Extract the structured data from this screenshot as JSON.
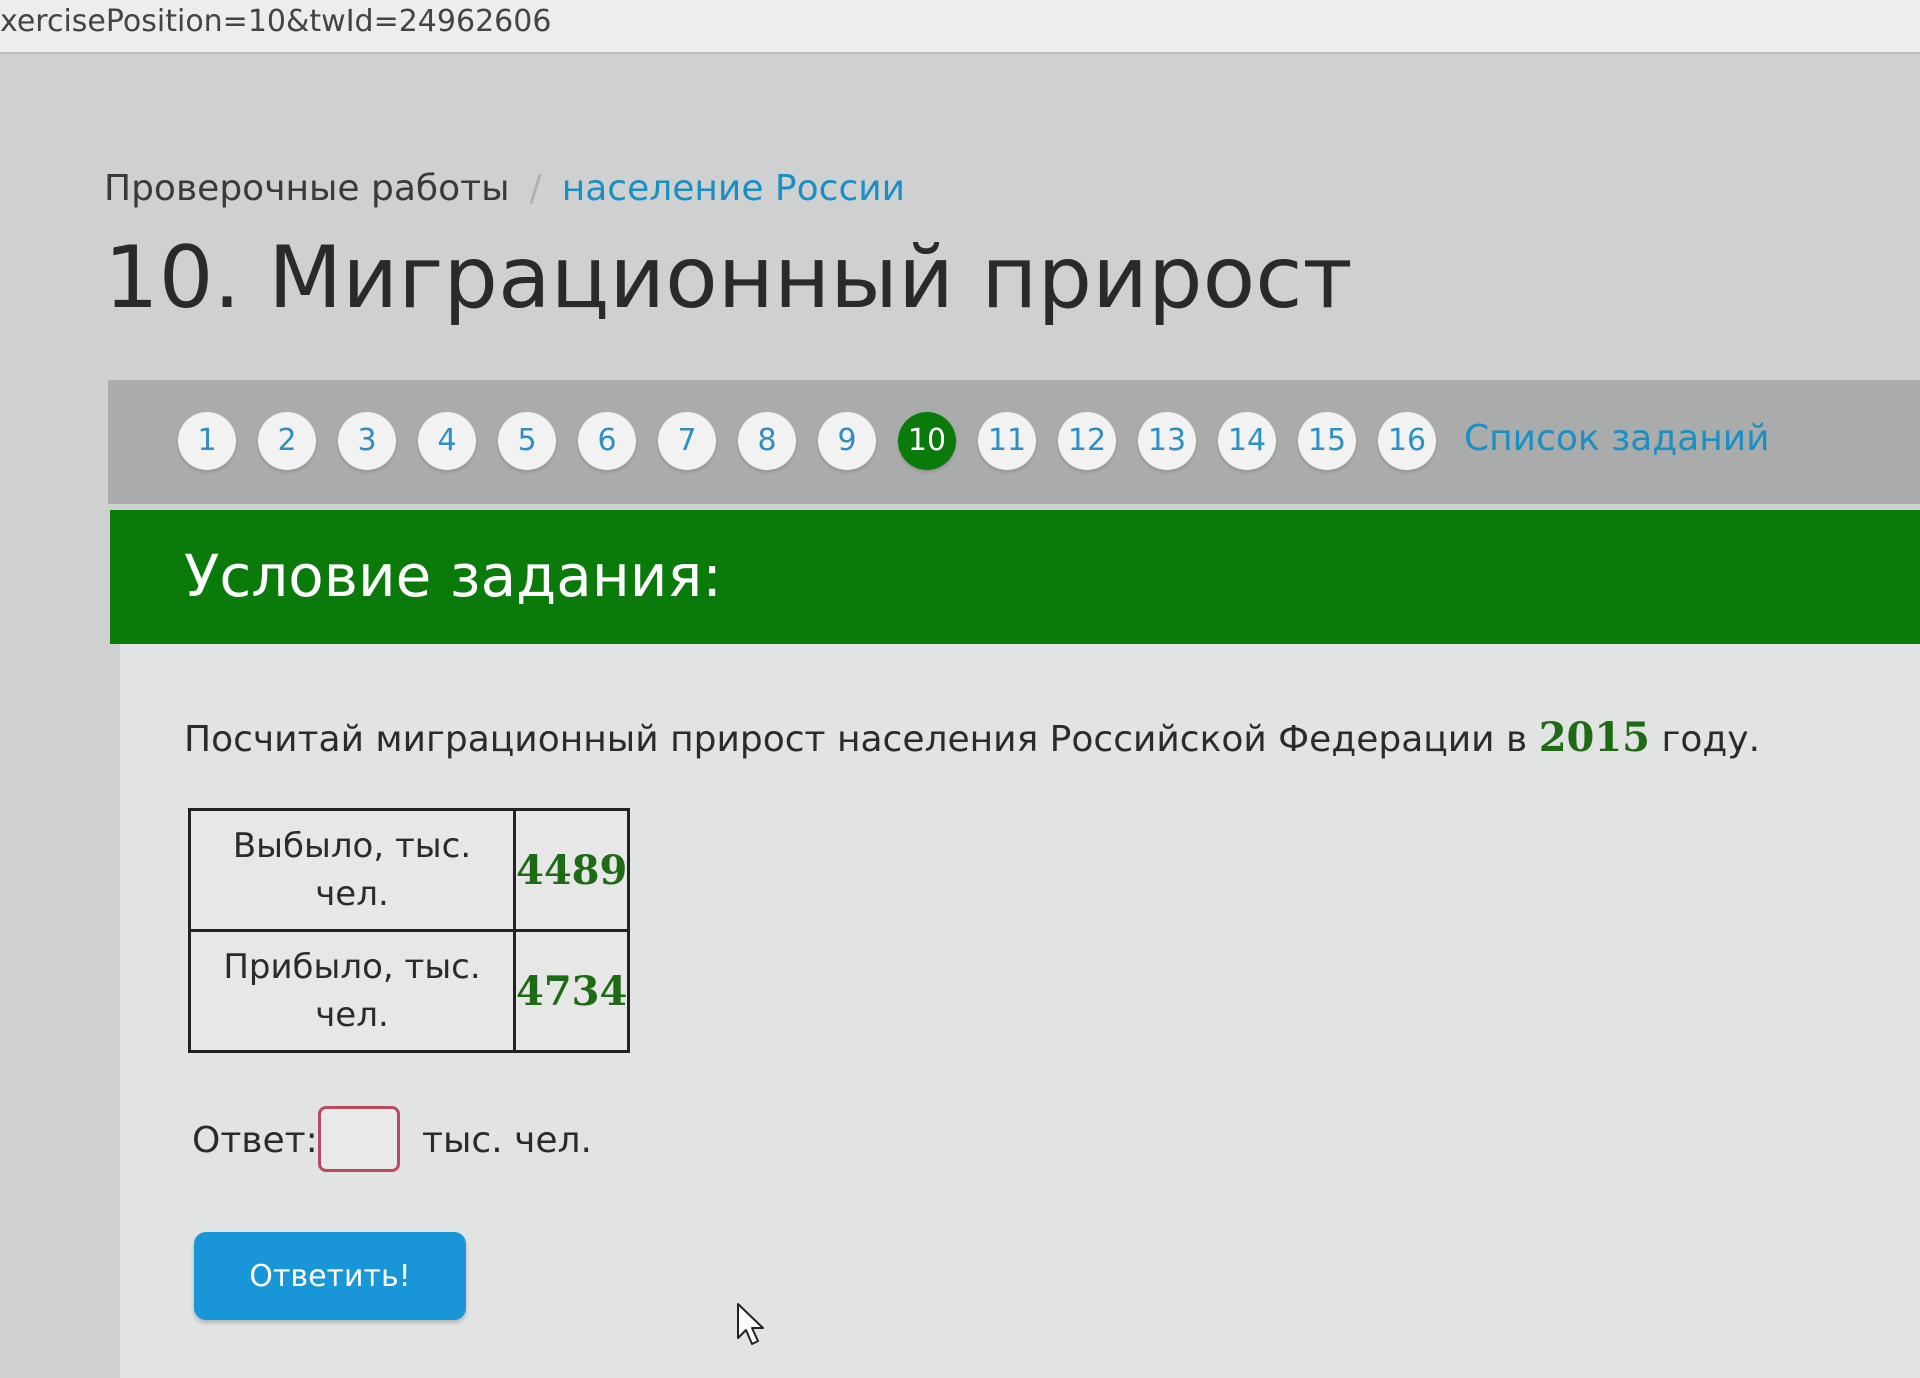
{
  "browser": {
    "url_text": "xercisePosition=10&twId=24962606"
  },
  "breadcrumb": {
    "parent": "Проверочные работы",
    "separator": "/",
    "current": "население России"
  },
  "page_title": "10. Миграционный прирост",
  "nav": {
    "items": [
      "1",
      "2",
      "3",
      "4",
      "5",
      "6",
      "7",
      "8",
      "9",
      "10",
      "11",
      "12",
      "13",
      "14",
      "15",
      "16"
    ],
    "active": "10",
    "list_link": "Список заданий"
  },
  "task": {
    "header": "Условие задания:",
    "question_prefix": "Посчитай миграционный прирост населения Российской Федерации в",
    "question_year": "2015",
    "question_suffix": "году.",
    "table": [
      {
        "label": "Выбыло, тыс. чел.",
        "value": "4489"
      },
      {
        "label": "Прибыло, тыс. чел.",
        "value": "4734"
      }
    ],
    "answer_label": "Ответ:",
    "answer_value": "",
    "answer_unit": "тыс. чел.",
    "submit_label": "Ответить!"
  },
  "colors": {
    "accent_green": "#0a7a0a",
    "link_blue": "#1a8fc4",
    "button_blue": "#1896d8"
  }
}
